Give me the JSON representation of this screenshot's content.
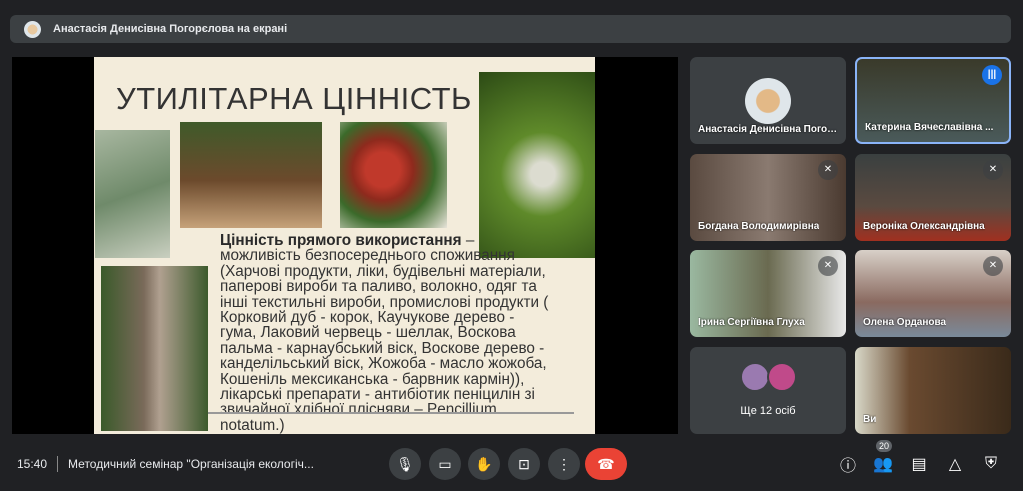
{
  "banner": {
    "text": "Анастасія Денисівна Погорєлова на екрані"
  },
  "slide": {
    "title": "УТИЛІТАРНА ЦІННІСТЬ",
    "bold": "Цінність прямого використання",
    "text": " – можливість безпосереднього споживання (Харчові продукти, ліки, будівельні матеріали, паперові вироби та паливо, волокно, одяг та інші текстильні вироби, промислові продукти ( Корковий дуб - корок, Каучукове дерево - гума, Лаковий червець - шеллак, Воскова пальма - карнаубський віск, Воскове дерево - канделільський віск, Жожоба - масло жожоба, Кошеніль мексиканська - барвник кармін)), лікарські препарати - антибіотик пеніцилін зі звичайної хлібної плісняви – Pencillium notatum.)"
  },
  "participants": [
    {
      "name": "Анастасія Денисівна Погорєлова"
    },
    {
      "name": "Катерина Вячеславівна ..."
    },
    {
      "name": "Богдана Володимирівна"
    },
    {
      "name": "Вероніка Олександрівна"
    },
    {
      "name": "Ірина Сергіївна Глуха"
    },
    {
      "name": "Олена Орданова"
    },
    {
      "name": "Ще 12 осіб"
    },
    {
      "name": "Ви"
    }
  ],
  "footer": {
    "time": "15:40",
    "meeting": "Методичний семінар \"Організація екологіч...",
    "participant_count": "20"
  }
}
